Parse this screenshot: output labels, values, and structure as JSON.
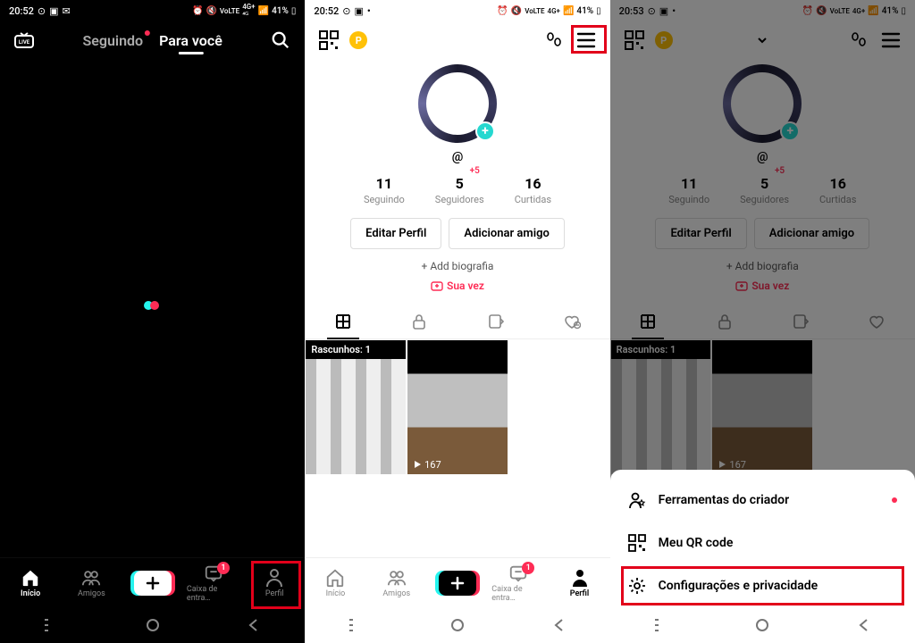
{
  "statusbar": {
    "time1": "20:52",
    "time2": "20:52",
    "time3": "20:53",
    "battery": "41%"
  },
  "feed": {
    "tab_following": "Seguindo",
    "tab_foryou": "Para você"
  },
  "nav": {
    "home": "Início",
    "friends": "Amigos",
    "inbox": "Caixa de entra…",
    "profile": "Perfil",
    "inbox_badge": "1"
  },
  "profile": {
    "username": "@",
    "stats": {
      "following_n": "11",
      "following_l": "Seguindo",
      "followers_n": "5",
      "followers_delta": "+5",
      "followers_l": "Seguidores",
      "likes_n": "16",
      "likes_l": "Curtidas"
    },
    "edit_btn": "Editar Perfil",
    "addfriend_btn": "Adicionar amigo",
    "add_bio": "+ Add biografia",
    "sua_vez": "Sua vez",
    "drafts_label": "Rascunhos: 1",
    "views": "167"
  },
  "sheet": {
    "creator_tools": "Ferramentas do criador",
    "qr": "Meu QR code",
    "settings": "Configurações e privacidade"
  }
}
